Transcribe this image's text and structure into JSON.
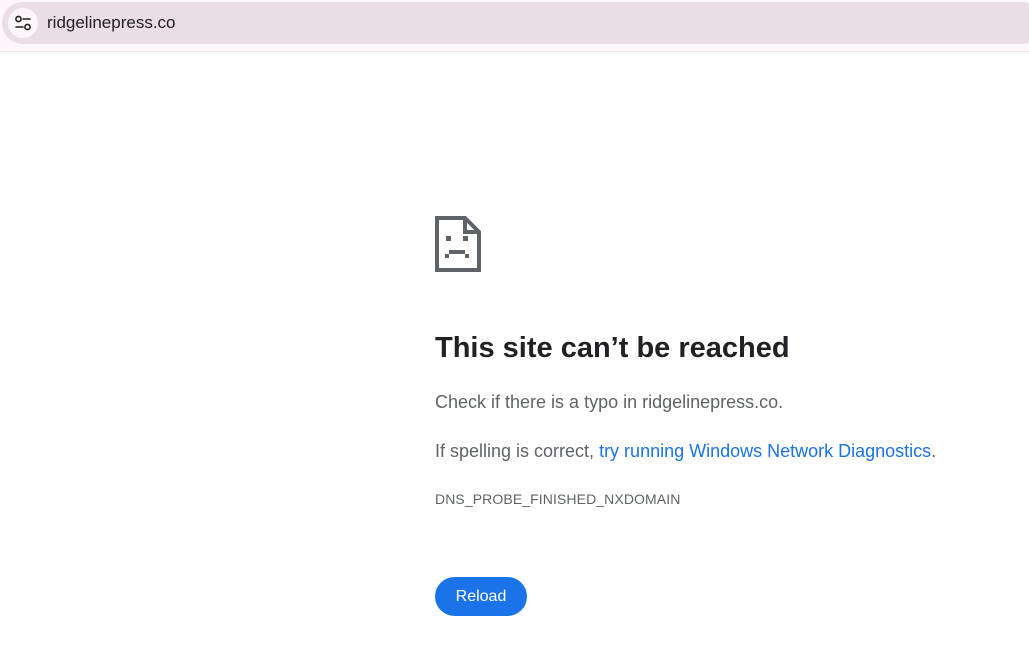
{
  "address_bar": {
    "url": "ridgelinepress.co",
    "site_info_icon": "tune-icon"
  },
  "error_page": {
    "icon": "sad-page-icon",
    "title": "This site can’t be reached",
    "check_text": "Check if there is a typo in ridgelinepress.co.",
    "spelling_prefix": "If spelling is correct, ",
    "diagnostics_link": "try running Windows Network Diagnostics",
    "spelling_suffix": ".",
    "error_code": "DNS_PROBE_FINISHED_NXDOMAIN",
    "reload_label": "Reload"
  },
  "colors": {
    "accent": "#1a73e8",
    "title": "#202124",
    "body_text": "#5f6368",
    "omnibox_bg": "#eadde6"
  }
}
